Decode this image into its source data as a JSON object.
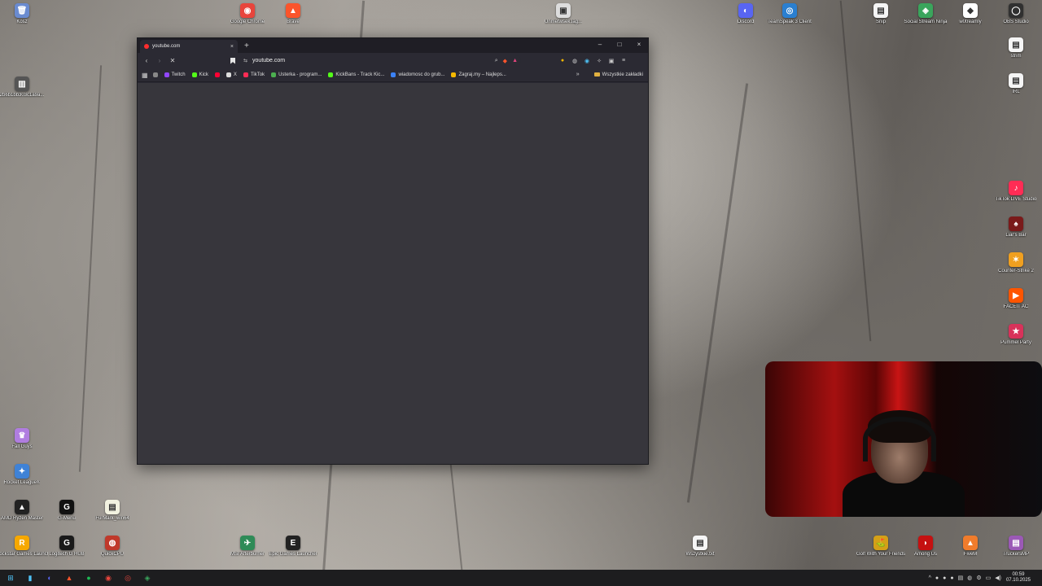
{
  "desktop": {
    "icons_top": [
      {
        "label": "Kosz",
        "color": "#6a8bd0",
        "glyph": "🗑"
      },
      {
        "label": "Google Chrome",
        "color": "#e8453c",
        "glyph": "◉"
      },
      {
        "label": "Brave",
        "color": "#fb542b",
        "glyph": "▲"
      },
      {
        "label": "Unmetwsek.lag...",
        "color": "#dddddd",
        "glyph": "▣"
      },
      {
        "label": "Discord",
        "color": "#5865f2",
        "glyph": "◐"
      },
      {
        "label": "TeamSpeak 3 Client",
        "color": "#2a7fd0",
        "glyph": "◎"
      },
      {
        "label": "Snip",
        "color": "#f5f5f5",
        "glyph": "▤"
      },
      {
        "label": "Social Stream Ninja",
        "color": "#3aa55c",
        "glyph": "◈"
      },
      {
        "label": "w0treamly",
        "color": "#ffffff",
        "glyph": "◆"
      },
      {
        "label": "OBS Studio",
        "color": "#303030",
        "glyph": "◯"
      }
    ],
    "icons_left": [
      {
        "label": "2b6b1bb303c1a9a...",
        "color": "#555555",
        "glyph": "▥"
      },
      {
        "label": "Fall Guys",
        "color": "#b07de0",
        "glyph": "♛"
      },
      {
        "label": "Rocket League®",
        "color": "#3f82d6",
        "glyph": "✦"
      },
      {
        "label": "AMD Ryzen Master",
        "color": "#222222",
        "glyph": "▲"
      },
      {
        "label": "G-Menu",
        "color": "#111111",
        "glyph": "G"
      },
      {
        "label": "FurMark_win64",
        "color": "#f2f2e0",
        "glyph": "▤"
      },
      {
        "label": "Rockstar Games Launcher",
        "color": "#f6a800",
        "glyph": "R"
      },
      {
        "label": "Logitech G HUB",
        "color": "#1a1a1a",
        "glyph": "G"
      },
      {
        "label": "QuickCPU",
        "color": "#c0392b",
        "glyph": "◍"
      },
      {
        "label": "MSI Afterburner",
        "color": "#2e8b57",
        "glyph": "✈"
      },
      {
        "label": "Epic Games Launcher",
        "color": "#222222",
        "glyph": "E"
      },
      {
        "label": "Wszystkie.txt",
        "color": "#f5f5f5",
        "glyph": "▤"
      },
      {
        "label": "Golf With Your Friends",
        "color": "#d4a017",
        "glyph": "⛳"
      },
      {
        "label": "Among Us",
        "color": "#c51111",
        "glyph": "◗"
      },
      {
        "label": "FiveM",
        "color": "#f07c2c",
        "glyph": "▲"
      },
      {
        "label": "TruckersMP",
        "color": "#9b59b6",
        "glyph": "▤"
      }
    ],
    "icons_right": [
      {
        "label": "strim",
        "color": "#f5f5f5",
        "glyph": "▤"
      },
      {
        "label": "IRL",
        "color": "#f5f5f5",
        "glyph": "▤"
      },
      {
        "label": "TikTok LIVE Studio",
        "color": "#ff2c55",
        "glyph": "♪"
      },
      {
        "label": "Liar's Bar",
        "color": "#7a1a1a",
        "glyph": "♠"
      },
      {
        "label": "Counter-Strike 2",
        "color": "#f0a020",
        "glyph": "✶"
      },
      {
        "label": "FACEIT AC",
        "color": "#ff5500",
        "glyph": "▶"
      },
      {
        "label": "Pummel Party",
        "color": "#d8325a",
        "glyph": "★"
      }
    ]
  },
  "browser": {
    "tab_title": "youtube.com",
    "tab_close": "×",
    "new_tab": "+",
    "win_min": "–",
    "win_max": "□",
    "win_close": "×",
    "back": "‹",
    "forward": "›",
    "stop": "✕",
    "site_info": "⇆",
    "url": "youtube.com",
    "zoom_icon": "⌕",
    "shield_icon": "◆",
    "rewards_icon": "▲",
    "menu_icon": "≡",
    "bookmarks": [
      {
        "label": "",
        "color": "#888888"
      },
      {
        "label": "Twitch",
        "color": "#9146ff"
      },
      {
        "label": "Kick",
        "color": "#53fc18"
      },
      {
        "label": "",
        "color": "#ff0033"
      },
      {
        "label": "X",
        "color": "#dddddd"
      },
      {
        "label": "TikTok",
        "color": "#ff2c55"
      },
      {
        "label": "Usterka - program...",
        "color": "#4caf50"
      },
      {
        "label": "KickBans - Track Kic...",
        "color": "#53fc18"
      },
      {
        "label": "wiadomosc do grub...",
        "color": "#3b82f6"
      },
      {
        "label": "Zagraj.my – Najleps...",
        "color": "#f5b800"
      }
    ],
    "bookmarks_more": "»",
    "all_bookmarks": "Wszystkie zakładki"
  },
  "taskbar": {
    "items": [
      {
        "glyph": "⊞",
        "color": "#4fc3f7",
        "name": "start-icon"
      },
      {
        "glyph": "▮",
        "color": "#4fc3f7",
        "name": "file-explorer-icon"
      },
      {
        "glyph": "◐",
        "color": "#5865f2",
        "name": "discord-taskbar-icon"
      },
      {
        "glyph": "▲",
        "color": "#fb542b",
        "name": "brave-taskbar-icon"
      },
      {
        "glyph": "●",
        "color": "#1db954",
        "name": "spotify-taskbar-icon"
      },
      {
        "glyph": "◉",
        "color": "#e8453c",
        "name": "chrome-taskbar-icon"
      },
      {
        "glyph": "◎",
        "color": "#e8453c",
        "name": "app-taskbar-icon"
      },
      {
        "glyph": "◈",
        "color": "#3aa55c",
        "name": "stream-taskbar-icon"
      }
    ],
    "tray": [
      "^",
      "●",
      "●",
      "●",
      "▤",
      "◍",
      "⚙",
      "▭",
      "◀)"
    ],
    "time": "00:59",
    "date": "07.10.2025"
  }
}
